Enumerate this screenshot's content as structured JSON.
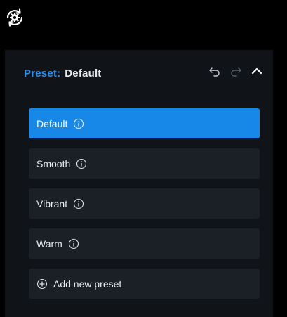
{
  "preset_header": {
    "label": "Preset:",
    "value": "Default"
  },
  "presets": [
    {
      "label": "Default",
      "active": true
    },
    {
      "label": "Smooth",
      "active": false
    },
    {
      "label": "Vibrant",
      "active": false
    },
    {
      "label": "Warm",
      "active": false
    }
  ],
  "add_preset": {
    "label": "Add new preset"
  },
  "icons": {
    "top": "gear-sync-icon",
    "undo": "undo-icon",
    "redo": "redo-icon",
    "collapse": "chevron-up-icon",
    "info": "info-icon",
    "add": "add-circle-icon"
  },
  "colors": {
    "accent": "#1787e8",
    "label_accent": "#2c8ce6",
    "panel_bg": "#101419",
    "item_bg": "#1b2026"
  }
}
